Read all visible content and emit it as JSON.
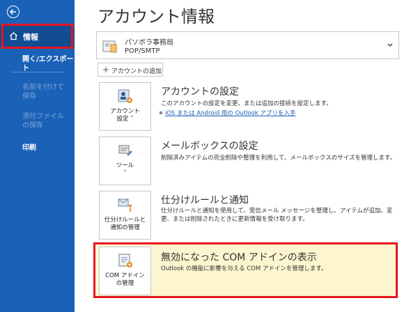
{
  "sidebar": {
    "info": "情報",
    "open_export": "開く/エクスポート",
    "save_as": "名前を付けて保存",
    "save_attachments": "添付ファイルの保存",
    "print": "印刷"
  },
  "main": {
    "title": "アカウント情報",
    "account": {
      "name": "パソボラ事務局",
      "type": "POP/SMTP"
    },
    "add_account": "アカウントの追加",
    "sections": [
      {
        "tile_label_1": "アカウント",
        "tile_label_2": "設定 ˅",
        "heading": "アカウントの設定",
        "desc": "このアカウントの設定を変更、または追加の接続を設定します。",
        "link": "iOS または Android 用の Outlook アプリを入手"
      },
      {
        "tile_label_1": "ツール",
        "tile_label_2": "˅",
        "heading": "メールボックスの設定",
        "desc": "削除済みアイテムの完全削除や整理を利用して、メールボックスのサイズを管理します。"
      },
      {
        "tile_label_1": "仕分けルールと",
        "tile_label_2": "通知の管理",
        "heading": "仕分けルールと通知",
        "desc": "仕分けルールと通知を使用して、受信メール メッセージを整理し、アイテムが追加、変更、または削除されたときに更新情報を受け取ります。"
      },
      {
        "tile_label_1": "COM アドイン",
        "tile_label_2": "の管理",
        "heading": "無効になった COM アドインの表示",
        "desc": "Outlook の機能に影響を与える COM アドインを管理します。"
      }
    ]
  },
  "colors": {
    "sidebar": "#1a62b7",
    "highlight": "#e8141e",
    "com_panel": "#fdf5cf",
    "link": "#1a5fb4"
  }
}
